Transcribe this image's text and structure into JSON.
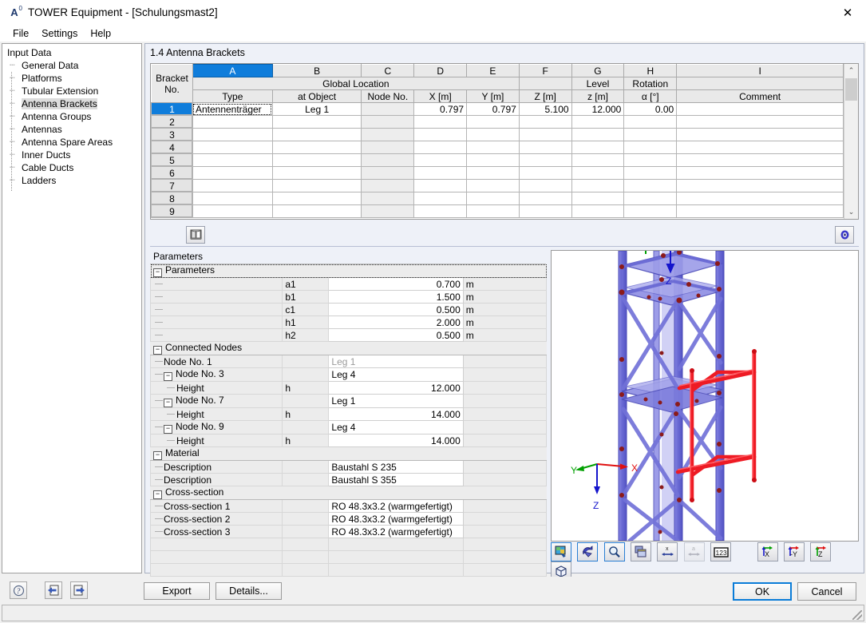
{
  "window": {
    "title": "TOWER Equipment - [Schulungsmast2]",
    "icon": "tower-app-icon",
    "close_label": "✕"
  },
  "menubar": {
    "items": [
      {
        "label": "File"
      },
      {
        "label": "Settings"
      },
      {
        "label": "Help"
      }
    ]
  },
  "sidebar": {
    "root": "Input Data",
    "items": [
      {
        "label": "General Data",
        "selected": false
      },
      {
        "label": "Platforms",
        "selected": false
      },
      {
        "label": "Tubular Extension",
        "selected": false
      },
      {
        "label": "Antenna Brackets",
        "selected": true
      },
      {
        "label": "Antenna Groups",
        "selected": false
      },
      {
        "label": "Antennas",
        "selected": false
      },
      {
        "label": "Antenna Spare Areas",
        "selected": false
      },
      {
        "label": "Inner Ducts",
        "selected": false
      },
      {
        "label": "Cable Ducts",
        "selected": false
      },
      {
        "label": "Ladders",
        "selected": false
      }
    ]
  },
  "main": {
    "section_title": "1.4 Antenna Brackets"
  },
  "table": {
    "column_letters": [
      "A",
      "B",
      "C",
      "D",
      "E",
      "F",
      "G",
      "H",
      "I"
    ],
    "selected_column": "A",
    "corner_header": [
      "Bracket",
      "No."
    ],
    "group_header": "Global Location",
    "headers_top": [
      "",
      "",
      "",
      "",
      "",
      "Level",
      "Rotation",
      ""
    ],
    "headers": [
      {
        "top": "",
        "bottom": "Type"
      },
      {
        "top": "",
        "bottom": "at Object"
      },
      {
        "top": "",
        "bottom": "Node No."
      },
      {
        "top": "",
        "bottom": "X [m]"
      },
      {
        "top": "",
        "bottom": "Y [m]"
      },
      {
        "top": "",
        "bottom": "Z [m]"
      },
      {
        "top": "Level",
        "bottom": "z [m]"
      },
      {
        "top": "Rotation",
        "bottom": "α [°]"
      },
      {
        "top": "",
        "bottom": "Comment"
      }
    ],
    "rows": [
      {
        "no": "1",
        "selected": true,
        "cells": [
          "Antennenträger",
          "Leg 1",
          "",
          "0.797",
          "0.797",
          "5.100",
          "12.000",
          "0.00",
          ""
        ]
      },
      {
        "no": "2",
        "selected": false,
        "cells": [
          "",
          "",
          "",
          "",
          "",
          "",
          "",
          "",
          ""
        ]
      },
      {
        "no": "3",
        "selected": false,
        "cells": [
          "",
          "",
          "",
          "",
          "",
          "",
          "",
          "",
          ""
        ]
      },
      {
        "no": "4",
        "selected": false,
        "cells": [
          "",
          "",
          "",
          "",
          "",
          "",
          "",
          "",
          ""
        ]
      },
      {
        "no": "5",
        "selected": false,
        "cells": [
          "",
          "",
          "",
          "",
          "",
          "",
          "",
          "",
          ""
        ]
      },
      {
        "no": "6",
        "selected": false,
        "cells": [
          "",
          "",
          "",
          "",
          "",
          "",
          "",
          "",
          ""
        ]
      },
      {
        "no": "7",
        "selected": false,
        "cells": [
          "",
          "",
          "",
          "",
          "",
          "",
          "",
          "",
          ""
        ]
      },
      {
        "no": "8",
        "selected": false,
        "cells": [
          "",
          "",
          "",
          "",
          "",
          "",
          "",
          "",
          ""
        ]
      },
      {
        "no": "9",
        "selected": false,
        "cells": [
          "",
          "",
          "",
          "",
          "",
          "",
          "",
          "",
          ""
        ]
      }
    ],
    "scroll_up": "⌃",
    "scroll_down": "⌄"
  },
  "table_toolbar": {
    "left_icon": "book-open-icon",
    "right_icon": "eye-visibility-icon"
  },
  "parameters": {
    "panel_title": "Parameters",
    "groups": [
      {
        "title": "Parameters",
        "focused": true,
        "rows": [
          {
            "label": "",
            "symbol": "a1",
            "value": "0.700",
            "unit": "m",
            "indent": 1,
            "align": "right"
          },
          {
            "label": "",
            "symbol": "b1",
            "value": "1.500",
            "unit": "m",
            "indent": 1,
            "align": "right"
          },
          {
            "label": "",
            "symbol": "c1",
            "value": "0.500",
            "unit": "m",
            "indent": 1,
            "align": "right"
          },
          {
            "label": "",
            "symbol": "h1",
            "value": "2.000",
            "unit": "m",
            "indent": 1,
            "align": "right"
          },
          {
            "label": "",
            "symbol": "h2",
            "value": "0.500",
            "unit": "m",
            "indent": 1,
            "align": "right"
          }
        ]
      },
      {
        "title": "Connected Nodes",
        "focused": false,
        "rows": [
          {
            "label": "Node No. 1",
            "symbol": "",
            "value": "Leg 1",
            "unit": "",
            "indent": 1,
            "align": "left",
            "dim": true
          },
          {
            "label": "Node No. 3",
            "symbol": "",
            "value": "Leg 4",
            "unit": "",
            "indent": 1,
            "align": "left",
            "expander": "−"
          },
          {
            "label": "Height",
            "symbol": "h",
            "value": "12.000",
            "unit": "",
            "indent": 2,
            "align": "right"
          },
          {
            "label": "Node No. 7",
            "symbol": "",
            "value": "Leg 1",
            "unit": "",
            "indent": 1,
            "align": "left",
            "expander": "−"
          },
          {
            "label": "Height",
            "symbol": "h",
            "value": "14.000",
            "unit": "",
            "indent": 2,
            "align": "right"
          },
          {
            "label": "Node No. 9",
            "symbol": "",
            "value": "Leg 4",
            "unit": "",
            "indent": 1,
            "align": "left",
            "expander": "−"
          },
          {
            "label": "Height",
            "symbol": "h",
            "value": "14.000",
            "unit": "",
            "indent": 2,
            "align": "right"
          }
        ]
      },
      {
        "title": "Material",
        "focused": false,
        "rows": [
          {
            "label": "Description",
            "symbol": "",
            "value": "Baustahl S 235",
            "unit": "",
            "indent": 1,
            "align": "left"
          },
          {
            "label": "Description",
            "symbol": "",
            "value": "Baustahl S 355",
            "unit": "",
            "indent": 1,
            "align": "left"
          }
        ]
      },
      {
        "title": "Cross-section",
        "focused": false,
        "rows": [
          {
            "label": "Cross-section 1",
            "symbol": "",
            "value": "RO 48.3x3.2 (warmgefertigt)",
            "unit": "",
            "indent": 1,
            "align": "left"
          },
          {
            "label": "Cross-section 2",
            "symbol": "",
            "value": "RO 48.3x3.2 (warmgefertigt)",
            "unit": "",
            "indent": 1,
            "align": "left"
          },
          {
            "label": "Cross-section 3",
            "symbol": "",
            "value": "RO 48.3x3.2 (warmgefertigt)",
            "unit": "",
            "indent": 1,
            "align": "left"
          }
        ]
      }
    ],
    "empty_rows": 3
  },
  "viewport": {
    "axis_labels": {
      "x": "X",
      "y": "Y",
      "z": "Z",
      "z_top": "Z"
    },
    "colors": {
      "structure": "#6f6fd8",
      "structure_light": "#9a9ae8",
      "bracket": "#ee1b24",
      "node": "#8b1a1a",
      "axis_x": "#e01010",
      "axis_y": "#00a000",
      "axis_z": "#0000d0"
    }
  },
  "view_toolbar": {
    "buttons": [
      {
        "name": "render-mode-icon",
        "label": "",
        "state": "active"
      },
      {
        "name": "rotate-model-icon",
        "label": "",
        "state": "active"
      },
      {
        "name": "zoom-magnifier-icon",
        "label": "",
        "state": "active"
      },
      {
        "name": "layers-icon",
        "label": "",
        "state": "normal"
      },
      {
        "name": "dimension-x-icon",
        "label": "x",
        "state": "normal"
      },
      {
        "name": "dimension-a-icon",
        "label": "a",
        "state": "disabled"
      },
      {
        "name": "numbering-icon",
        "label": "123",
        "state": "normal"
      },
      {
        "name": "view-x-icon",
        "label": "X",
        "state": "normal"
      },
      {
        "name": "view-minus-y-icon",
        "label": "-Y",
        "state": "normal"
      },
      {
        "name": "view-z-icon",
        "label": "Z",
        "state": "normal"
      },
      {
        "name": "isometric-view-icon",
        "label": "",
        "state": "normal"
      }
    ]
  },
  "footer": {
    "icons": [
      {
        "name": "help-question-icon"
      },
      {
        "name": "previous-page-icon"
      },
      {
        "name": "next-page-icon"
      }
    ],
    "export_label": "Export",
    "details_label": "Details...",
    "ok_label": "OK",
    "cancel_label": "Cancel"
  }
}
